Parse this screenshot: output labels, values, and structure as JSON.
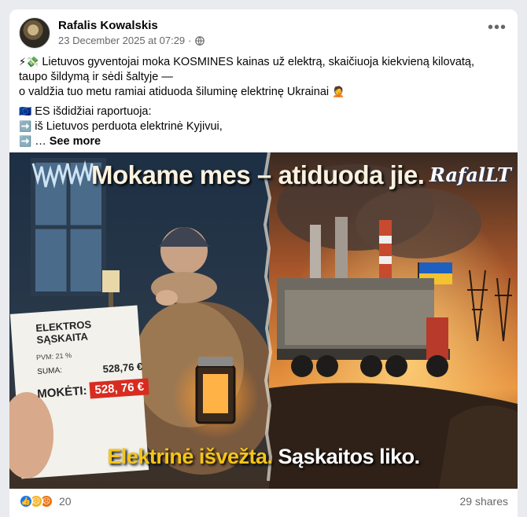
{
  "post": {
    "author": "Rafalis Kowalskis",
    "timestamp": "23 December 2025 at 07:29",
    "separator": "·",
    "more_icon": "more-horizontal-icon",
    "lines": [
      {
        "emoji": "⚡💸",
        "text": " Lietuvos gyventojai moka KOSMINES kainas už elektrą, skaičiuoja kiekvieną kilovatą,"
      },
      {
        "emoji": "",
        "text": "taupo šildymą ir sėdi šaltyje —"
      },
      {
        "emoji": "",
        "text": "o valdžia tuo metu ramiai atiduoda šiluminę elektrinę Ukrainai",
        "tail_emoji": "🤦"
      }
    ],
    "lines2": [
      {
        "emoji": "🇪🇺",
        "text": " ES išdidžiai raportuoja:"
      },
      {
        "emoji": "➡️",
        "text": " iš Lietuvos perduota elektrinė Kyjivui,"
      },
      {
        "emoji": "➡️",
        "text": " … "
      }
    ],
    "see_more": "See more"
  },
  "image": {
    "headline": "Mokame mes – atiduoda jie.",
    "logo": "RafalLT",
    "bill_title": "ELEKTROS SĄSKAITA",
    "bill_pvm": "PVM: 21 %",
    "bill_suma_label": "SUMA:",
    "bill_suma_value": "528,76 €",
    "bill_moketi_label": "MOKĖTI:",
    "bill_moketi_value": "528, 76 €",
    "caption_left": "Elektrinė išvežta.",
    "caption_right": "Sąskaitos liko."
  },
  "footer": {
    "reaction_icons": [
      "like-icon",
      "sad-icon",
      "angry-icon"
    ],
    "reaction_count": "20",
    "shares": "29 shares"
  },
  "colors": {
    "like": "#1877f2",
    "sad": "#f7b125",
    "angry": "#e9710f",
    "bill_red": "#d82c20",
    "caption_yellow": "#f5c518"
  }
}
